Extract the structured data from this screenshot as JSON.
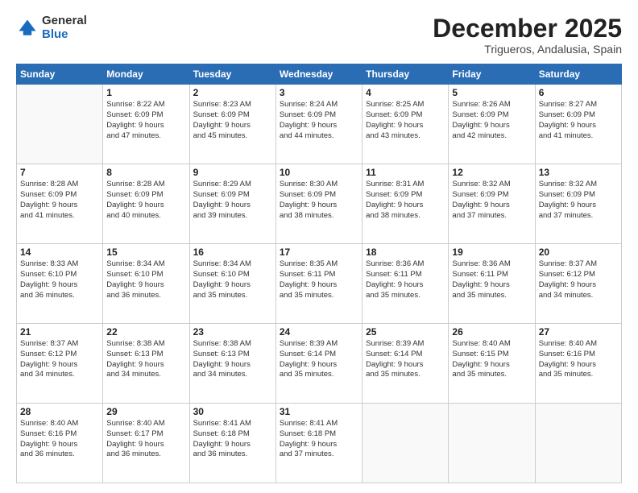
{
  "logo": {
    "general": "General",
    "blue": "Blue"
  },
  "header": {
    "month": "December 2025",
    "location": "Trigueros, Andalusia, Spain"
  },
  "weekdays": [
    "Sunday",
    "Monday",
    "Tuesday",
    "Wednesday",
    "Thursday",
    "Friday",
    "Saturday"
  ],
  "weeks": [
    [
      {
        "day": "",
        "info": ""
      },
      {
        "day": "1",
        "info": "Sunrise: 8:22 AM\nSunset: 6:09 PM\nDaylight: 9 hours\nand 47 minutes."
      },
      {
        "day": "2",
        "info": "Sunrise: 8:23 AM\nSunset: 6:09 PM\nDaylight: 9 hours\nand 45 minutes."
      },
      {
        "day": "3",
        "info": "Sunrise: 8:24 AM\nSunset: 6:09 PM\nDaylight: 9 hours\nand 44 minutes."
      },
      {
        "day": "4",
        "info": "Sunrise: 8:25 AM\nSunset: 6:09 PM\nDaylight: 9 hours\nand 43 minutes."
      },
      {
        "day": "5",
        "info": "Sunrise: 8:26 AM\nSunset: 6:09 PM\nDaylight: 9 hours\nand 42 minutes."
      },
      {
        "day": "6",
        "info": "Sunrise: 8:27 AM\nSunset: 6:09 PM\nDaylight: 9 hours\nand 41 minutes."
      }
    ],
    [
      {
        "day": "7",
        "info": "Sunrise: 8:28 AM\nSunset: 6:09 PM\nDaylight: 9 hours\nand 41 minutes."
      },
      {
        "day": "8",
        "info": "Sunrise: 8:28 AM\nSunset: 6:09 PM\nDaylight: 9 hours\nand 40 minutes."
      },
      {
        "day": "9",
        "info": "Sunrise: 8:29 AM\nSunset: 6:09 PM\nDaylight: 9 hours\nand 39 minutes."
      },
      {
        "day": "10",
        "info": "Sunrise: 8:30 AM\nSunset: 6:09 PM\nDaylight: 9 hours\nand 38 minutes."
      },
      {
        "day": "11",
        "info": "Sunrise: 8:31 AM\nSunset: 6:09 PM\nDaylight: 9 hours\nand 38 minutes."
      },
      {
        "day": "12",
        "info": "Sunrise: 8:32 AM\nSunset: 6:09 PM\nDaylight: 9 hours\nand 37 minutes."
      },
      {
        "day": "13",
        "info": "Sunrise: 8:32 AM\nSunset: 6:09 PM\nDaylight: 9 hours\nand 37 minutes."
      }
    ],
    [
      {
        "day": "14",
        "info": "Sunrise: 8:33 AM\nSunset: 6:10 PM\nDaylight: 9 hours\nand 36 minutes."
      },
      {
        "day": "15",
        "info": "Sunrise: 8:34 AM\nSunset: 6:10 PM\nDaylight: 9 hours\nand 36 minutes."
      },
      {
        "day": "16",
        "info": "Sunrise: 8:34 AM\nSunset: 6:10 PM\nDaylight: 9 hours\nand 35 minutes."
      },
      {
        "day": "17",
        "info": "Sunrise: 8:35 AM\nSunset: 6:11 PM\nDaylight: 9 hours\nand 35 minutes."
      },
      {
        "day": "18",
        "info": "Sunrise: 8:36 AM\nSunset: 6:11 PM\nDaylight: 9 hours\nand 35 minutes."
      },
      {
        "day": "19",
        "info": "Sunrise: 8:36 AM\nSunset: 6:11 PM\nDaylight: 9 hours\nand 35 minutes."
      },
      {
        "day": "20",
        "info": "Sunrise: 8:37 AM\nSunset: 6:12 PM\nDaylight: 9 hours\nand 34 minutes."
      }
    ],
    [
      {
        "day": "21",
        "info": "Sunrise: 8:37 AM\nSunset: 6:12 PM\nDaylight: 9 hours\nand 34 minutes."
      },
      {
        "day": "22",
        "info": "Sunrise: 8:38 AM\nSunset: 6:13 PM\nDaylight: 9 hours\nand 34 minutes."
      },
      {
        "day": "23",
        "info": "Sunrise: 8:38 AM\nSunset: 6:13 PM\nDaylight: 9 hours\nand 34 minutes."
      },
      {
        "day": "24",
        "info": "Sunrise: 8:39 AM\nSunset: 6:14 PM\nDaylight: 9 hours\nand 35 minutes."
      },
      {
        "day": "25",
        "info": "Sunrise: 8:39 AM\nSunset: 6:14 PM\nDaylight: 9 hours\nand 35 minutes."
      },
      {
        "day": "26",
        "info": "Sunrise: 8:40 AM\nSunset: 6:15 PM\nDaylight: 9 hours\nand 35 minutes."
      },
      {
        "day": "27",
        "info": "Sunrise: 8:40 AM\nSunset: 6:16 PM\nDaylight: 9 hours\nand 35 minutes."
      }
    ],
    [
      {
        "day": "28",
        "info": "Sunrise: 8:40 AM\nSunset: 6:16 PM\nDaylight: 9 hours\nand 36 minutes."
      },
      {
        "day": "29",
        "info": "Sunrise: 8:40 AM\nSunset: 6:17 PM\nDaylight: 9 hours\nand 36 minutes."
      },
      {
        "day": "30",
        "info": "Sunrise: 8:41 AM\nSunset: 6:18 PM\nDaylight: 9 hours\nand 36 minutes."
      },
      {
        "day": "31",
        "info": "Sunrise: 8:41 AM\nSunset: 6:18 PM\nDaylight: 9 hours\nand 37 minutes."
      },
      {
        "day": "",
        "info": ""
      },
      {
        "day": "",
        "info": ""
      },
      {
        "day": "",
        "info": ""
      }
    ]
  ]
}
